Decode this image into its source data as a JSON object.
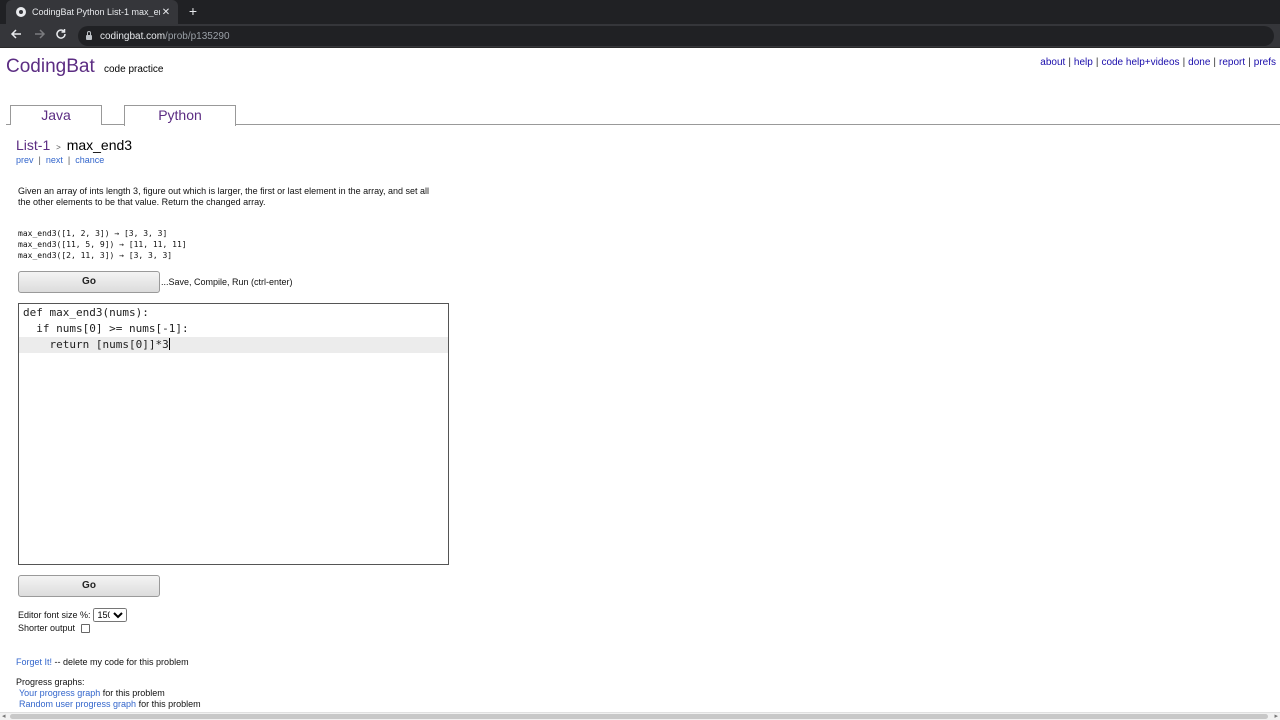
{
  "browser": {
    "tab_title": "CodingBat Python List-1 max_en",
    "tab_close": "✕",
    "new_tab": "+",
    "url_host": "codingbat.com",
    "url_path": "/prob/p135290"
  },
  "header": {
    "logo": "CodingBat",
    "logo_sub": "code practice",
    "links": [
      "about",
      "help",
      "code help+videos",
      "done",
      "report",
      "prefs"
    ]
  },
  "lang_tabs": [
    "Java",
    "Python"
  ],
  "breadcrumb": {
    "section": "List-1",
    "arrow": ">",
    "problem": "max_end3"
  },
  "nav": [
    "prev",
    "next",
    "chance"
  ],
  "description": "Given an array of ints length 3, figure out which is larger, the first or last element in the array, and set all the other elements to be that value. Return the changed array.",
  "examples": [
    "max_end3([1, 2, 3]) → [3, 3, 3]",
    "max_end3([11, 5, 9]) → [11, 11, 11]",
    "max_end3([2, 11, 3]) → [3, 3, 3]"
  ],
  "go_label": "Go",
  "go_hint": "...Save, Compile, Run (ctrl-enter)",
  "code_lines": [
    "def max_end3(nums):",
    "  if nums[0] >= nums[-1]:",
    "    return [nums[0]]*3"
  ],
  "editor_font_label": "Editor font size %:",
  "editor_font_value": "150",
  "shorter_output_label": "Shorter output",
  "forget_link": "Forget It!",
  "forget_text": " -- delete my code for this problem",
  "progress_label": "Progress graphs:",
  "progress_links": [
    {
      "link": "Your progress graph",
      "text": " for this problem"
    },
    {
      "link": "Random user progress graph",
      "text": " for this problem"
    }
  ]
}
